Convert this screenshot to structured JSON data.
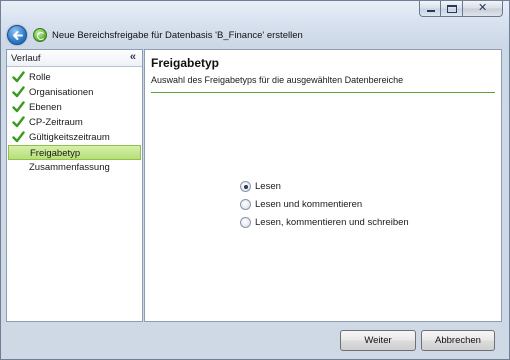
{
  "window": {
    "title": "Neue Bereichsfreigabe für Datenbasis 'B_Finance' erstellen"
  },
  "sidebar": {
    "header": "Verlauf",
    "collapse_icon": "«",
    "steps": [
      {
        "label": "Rolle",
        "done": true
      },
      {
        "label": "Organisationen",
        "done": true
      },
      {
        "label": "Ebenen",
        "done": true
      },
      {
        "label": "CP-Zeitraum",
        "done": true
      },
      {
        "label": "Gültigkeitszeitraum",
        "done": true
      },
      {
        "label": "Freigabetyp",
        "done": false,
        "active": true
      },
      {
        "label": "Zusammenfassung",
        "done": false
      }
    ]
  },
  "main": {
    "title": "Freigabetyp",
    "subtitle": "Auswahl des Freigabetyps für die ausgewählten Datenbereiche",
    "options": [
      {
        "label": "Lesen",
        "selected": true
      },
      {
        "label": "Lesen und kommentieren",
        "selected": false
      },
      {
        "label": "Lesen, kommentieren und schreiben",
        "selected": false
      }
    ]
  },
  "footer": {
    "next_label": "Weiter",
    "cancel_label": "Abbrechen"
  },
  "colors": {
    "accent_green": "#5fa13a",
    "active_step_bg": "#c6e890",
    "window_frame": "#cfd9e6"
  },
  "icons": {
    "back": "back-arrow-icon",
    "app": "app-refresh-icon",
    "check": "checkmark-icon"
  }
}
